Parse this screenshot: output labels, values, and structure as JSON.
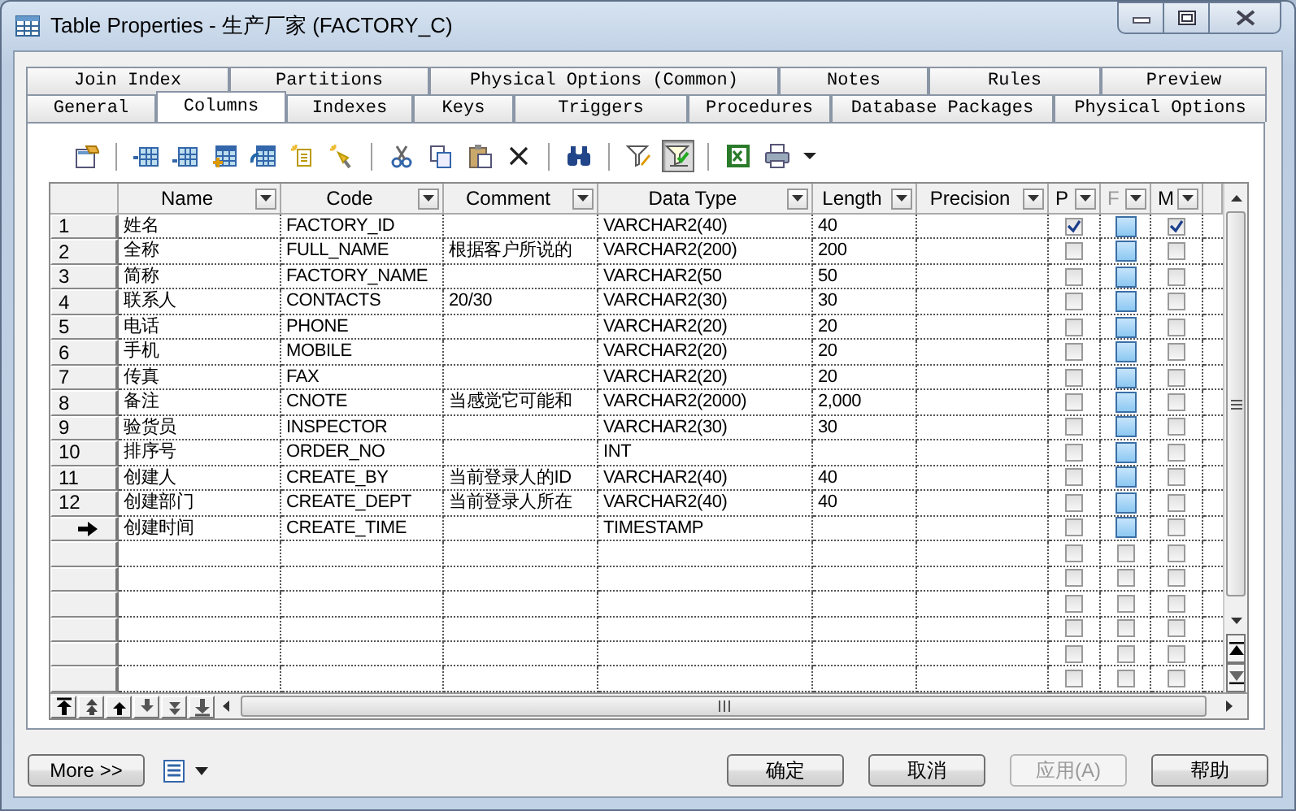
{
  "window": {
    "title": "Table Properties - 生产厂家 (FACTORY_C)"
  },
  "tab_rows": [
    {
      "tabs": [
        {
          "label": "Join Index",
          "selected": false
        },
        {
          "label": "Partitions",
          "selected": false
        },
        {
          "label": "Physical Options (Common)",
          "selected": false
        },
        {
          "label": "Notes",
          "selected": false
        },
        {
          "label": "Rules",
          "selected": false
        },
        {
          "label": "Preview",
          "selected": false
        }
      ]
    },
    {
      "tabs": [
        {
          "label": "General",
          "selected": false
        },
        {
          "label": "Columns",
          "selected": true
        },
        {
          "label": "Indexes",
          "selected": false
        },
        {
          "label": "Keys",
          "selected": false
        },
        {
          "label": "Triggers",
          "selected": false
        },
        {
          "label": "Procedures",
          "selected": false
        },
        {
          "label": "Database Packages",
          "selected": false
        },
        {
          "label": "Physical Options",
          "selected": false
        }
      ]
    }
  ],
  "toolbar": [
    {
      "kind": "properties",
      "pressed": false
    },
    {
      "kind": "separator"
    },
    {
      "kind": "insert-row",
      "pressed": false
    },
    {
      "kind": "add-row",
      "pressed": false
    },
    {
      "kind": "add-columns",
      "pressed": false
    },
    {
      "kind": "reuse-columns",
      "pressed": false
    },
    {
      "kind": "note",
      "pressed": false
    },
    {
      "kind": "wand",
      "pressed": false
    },
    {
      "kind": "separator"
    },
    {
      "kind": "cut",
      "pressed": false
    },
    {
      "kind": "copy",
      "pressed": false
    },
    {
      "kind": "paste",
      "pressed": false
    },
    {
      "kind": "delete",
      "pressed": false
    },
    {
      "kind": "separator"
    },
    {
      "kind": "find",
      "pressed": false
    },
    {
      "kind": "separator"
    },
    {
      "kind": "filter-edit",
      "pressed": false
    },
    {
      "kind": "filter",
      "pressed": true
    },
    {
      "kind": "separator"
    },
    {
      "kind": "excel",
      "pressed": false
    },
    {
      "kind": "print",
      "pressed": false
    },
    {
      "kind": "caret",
      "pressed": false
    }
  ],
  "table": {
    "columns": [
      {
        "label": "Name",
        "kind": "text",
        "disabled": false
      },
      {
        "label": "Code",
        "kind": "text",
        "disabled": false
      },
      {
        "label": "Comment",
        "kind": "text",
        "disabled": false
      },
      {
        "label": "Data Type",
        "kind": "text",
        "disabled": false
      },
      {
        "label": "Length",
        "kind": "text",
        "disabled": false
      },
      {
        "label": "Precision",
        "kind": "text",
        "disabled": false
      },
      {
        "label": "P",
        "kind": "check",
        "disabled": false,
        "highlighted": false
      },
      {
        "label": "F",
        "kind": "check",
        "disabled": true,
        "highlighted": true
      },
      {
        "label": "M",
        "kind": "check",
        "disabled": false,
        "highlighted": false
      }
    ],
    "rows": [
      {
        "kind": "data",
        "number": "1",
        "name": "姓名",
        "code": "FACTORY_ID",
        "data_type": "VARCHAR2(40)",
        "length": "40",
        "p": true,
        "f": false,
        "m": true
      },
      {
        "kind": "data",
        "number": "2",
        "name": "全称",
        "code": "FULL_NAME",
        "comment": "根据客户所说的",
        "data_type": "VARCHAR2(200)",
        "length": "200",
        "p": false,
        "f": false,
        "m": false
      },
      {
        "kind": "data",
        "number": "3",
        "name": "简称",
        "code": "FACTORY_NAME",
        "data_type": "VARCHAR2(50",
        "length": "50",
        "p": false,
        "f": false,
        "m": false
      },
      {
        "kind": "data",
        "number": "4",
        "name": "联系人",
        "code": "CONTACTS",
        "comment": "20/30",
        "data_type": "VARCHAR2(30)",
        "length": "30",
        "p": false,
        "f": false,
        "m": false
      },
      {
        "kind": "data",
        "number": "5",
        "name": "电话",
        "code": "PHONE",
        "data_type": "VARCHAR2(20)",
        "length": "20",
        "p": false,
        "f": false,
        "m": false
      },
      {
        "kind": "data",
        "number": "6",
        "name": "手机",
        "code": "MOBILE",
        "data_type": "VARCHAR2(20)",
        "length": "20",
        "p": false,
        "f": false,
        "m": false
      },
      {
        "kind": "data",
        "number": "7",
        "name": "传真",
        "code": "FAX",
        "data_type": "VARCHAR2(20)",
        "length": "20",
        "p": false,
        "f": false,
        "m": false
      },
      {
        "kind": "data",
        "number": "8",
        "name": "备注",
        "code": "CNOTE",
        "comment": "当感觉它可能和",
        "data_type": "VARCHAR2(2000)",
        "length": "2,000",
        "p": false,
        "f": false,
        "m": false
      },
      {
        "kind": "data",
        "number": "9",
        "name": "验货员",
        "code": "INSPECTOR",
        "data_type": "VARCHAR2(30)",
        "length": "30",
        "p": false,
        "f": false,
        "m": false
      },
      {
        "kind": "data",
        "number": "10",
        "name": "排序号",
        "code": "ORDER_NO",
        "data_type": "INT",
        "p": false,
        "f": false,
        "m": false
      },
      {
        "kind": "data",
        "number": "11",
        "name": "创建人",
        "code": "CREATE_BY",
        "comment": "当前登录人的ID",
        "data_type": "VARCHAR2(40)",
        "length": "40",
        "p": false,
        "f": false,
        "m": false
      },
      {
        "kind": "data",
        "number": "12",
        "name": "创建部门",
        "code": "CREATE_DEPT",
        "comment": "当前登录人所在",
        "data_type": "VARCHAR2(40)",
        "length": "40",
        "p": false,
        "f": false,
        "m": false
      },
      {
        "kind": "current",
        "name": "创建时间",
        "code": "CREATE_TIME",
        "data_type": "TIMESTAMP",
        "p": false,
        "f": false,
        "m": false
      },
      {
        "kind": "empty",
        "p": false,
        "f": false,
        "m": false
      },
      {
        "kind": "empty",
        "p": false,
        "f": false,
        "m": false
      },
      {
        "kind": "empty",
        "p": false,
        "f": false,
        "m": false
      },
      {
        "kind": "empty",
        "p": false,
        "f": false,
        "m": false
      },
      {
        "kind": "empty",
        "p": false,
        "f": false,
        "m": false
      },
      {
        "kind": "empty",
        "p": false,
        "f": false,
        "m": false
      }
    ]
  },
  "left_buttons": [
    {
      "label": "More >>",
      "disabled": false
    }
  ],
  "buttons": [
    {
      "label": "确定",
      "disabled": false
    },
    {
      "label": "取消",
      "disabled": false
    },
    {
      "label": "应用(A)",
      "disabled": true
    },
    {
      "label": "帮助",
      "disabled": false
    }
  ]
}
